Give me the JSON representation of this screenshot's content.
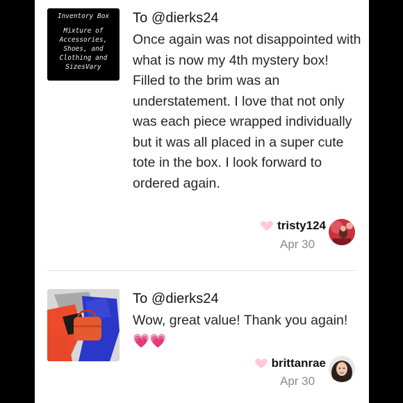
{
  "reviews": [
    {
      "thumbnail": {
        "kind": "text-card",
        "title": "Inventory Box",
        "description": "Mixture of Accessories, Shoes, and Clothing and SizesVary"
      },
      "to": "To @dierks24",
      "text": "Once again was not disappointed with what is now my 4th mystery box! Filled to the brim was an understatement. I love that not only was each piece wrapped individually but it was all placed in a super cute tote in the box. I look forward to ordered again.",
      "username": "tristy124",
      "date": "Apr 30",
      "heart_icon": "heart-icon"
    },
    {
      "thumbnail": {
        "kind": "photo",
        "subject": "folded clothing and orange bag"
      },
      "to": "To @dierks24",
      "text": "Wow, great value! Thank you again! 💗💗",
      "username": "brittanrae",
      "date": "Apr 30",
      "heart_icon": "heart-icon"
    }
  ],
  "colors": {
    "background": "#000000",
    "panel": "#ffffff",
    "heart": "#ffc9d3",
    "date": "#8a8a8a",
    "divider": "#dcdcdc"
  }
}
